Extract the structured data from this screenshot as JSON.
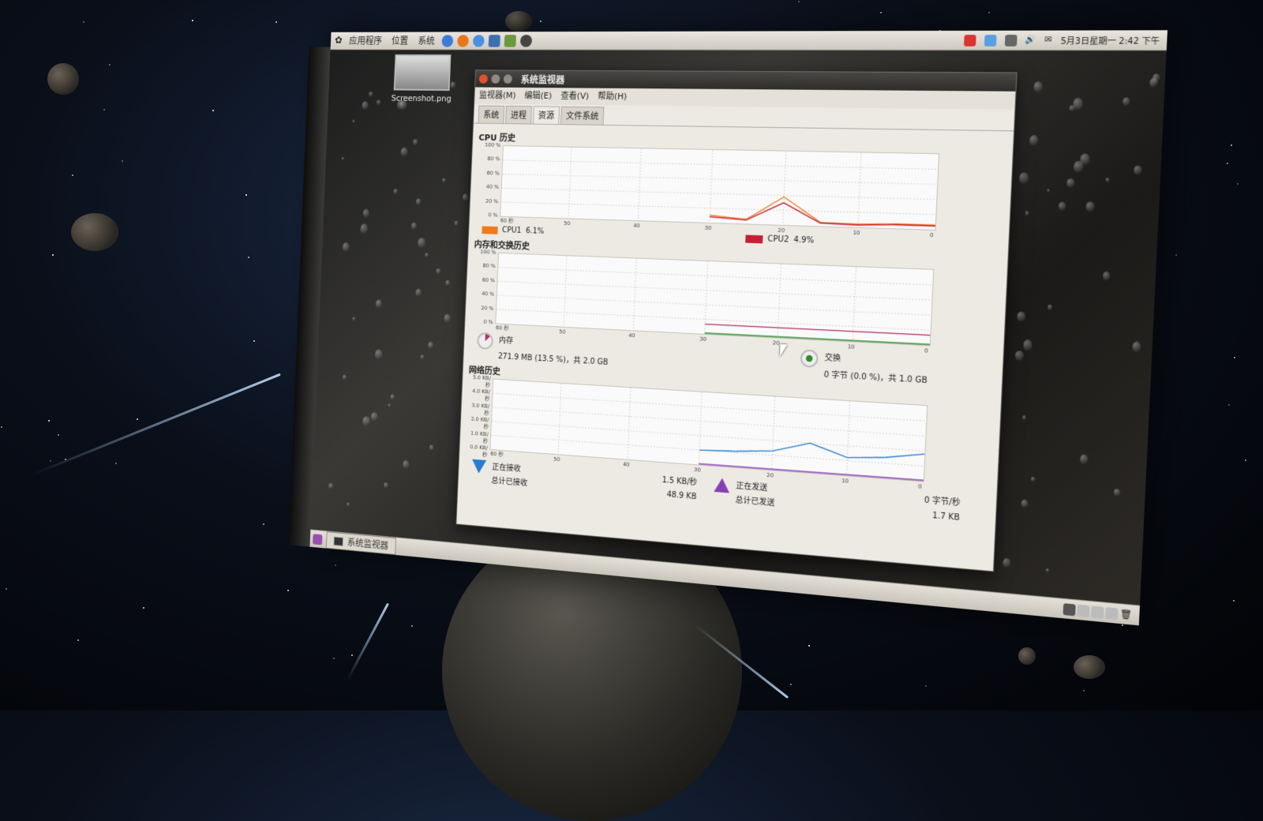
{
  "top_panel": {
    "menus": [
      "应用程序",
      "位置",
      "系统"
    ],
    "clock": "5月3日星期一 2:42 下午"
  },
  "desktop_icon": {
    "label": "Screenshot.png"
  },
  "window": {
    "title": "系统监视器",
    "menus": [
      "监视器(M)",
      "编辑(E)",
      "查看(V)",
      "帮助(H)"
    ],
    "tabs": [
      "系统",
      "进程",
      "资源",
      "文件系统"
    ],
    "active_tab": "资源",
    "cpu": {
      "title": "CPU 历史",
      "y_ticks": [
        "100 %",
        "80 %",
        "60 %",
        "40 %",
        "20 %",
        "0 %"
      ],
      "x_ticks": [
        "60 秒",
        "50",
        "40",
        "30",
        "20",
        "10",
        "0"
      ],
      "cpu1_label": "CPU1",
      "cpu1_value": "6.1%",
      "cpu2_label": "CPU2",
      "cpu2_value": "4.9%"
    },
    "mem": {
      "title": "内存和交换历史",
      "y_ticks": [
        "100 %",
        "80 %",
        "60 %",
        "40 %",
        "20 %",
        "0 %"
      ],
      "x_ticks": [
        "60 秒",
        "50",
        "40",
        "30",
        "20",
        "10",
        "0"
      ],
      "mem_label": "内存",
      "mem_value": "271.9 MB (13.5 %)，共 2.0 GB",
      "swap_label": "交换",
      "swap_value": "0 字节 (0.0 %)，共 1.0 GB"
    },
    "net": {
      "title": "网络历史",
      "y_ticks": [
        "5.0 KB/秒",
        "4.0 KB/秒",
        "3.0 KB/秒",
        "2.0 KB/秒",
        "1.0 KB/秒",
        "0.0 KB/秒"
      ],
      "x_ticks": [
        "60 秒",
        "50",
        "40",
        "30",
        "20",
        "10",
        "0"
      ],
      "recv_label": "正在接收",
      "recv_total_label": "总计已接收",
      "recv_rate": "1.5 KB/秒",
      "recv_total": "48.9 KB",
      "send_label": "正在发送",
      "send_total_label": "总计已发送",
      "send_rate": "0 字节/秒",
      "send_total": "1.7 KB"
    }
  },
  "taskbar": {
    "task_label": "系统监视器"
  },
  "colors": {
    "cpu1": "#f07a1a",
    "cpu2": "#c81e34",
    "mem": "#b3306a",
    "swap": "#2e8b2e",
    "recv": "#2a7bd0",
    "send": "#8a3fb3"
  },
  "chart_data": [
    {
      "type": "line",
      "title": "CPU 历史",
      "x": [
        60,
        50,
        40,
        30,
        25,
        20,
        15,
        10,
        5,
        0
      ],
      "series": [
        {
          "name": "CPU1",
          "values": [
            null,
            null,
            null,
            10,
            6,
            38,
            5,
            4,
            6,
            6.1
          ]
        },
        {
          "name": "CPU2",
          "values": [
            null,
            null,
            null,
            8,
            5,
            30,
            4,
            3,
            5,
            4.9
          ]
        }
      ],
      "ylim": [
        0,
        100
      ]
    },
    {
      "type": "line",
      "title": "内存和交换历史",
      "x": [
        30,
        20,
        10,
        0
      ],
      "series": [
        {
          "name": "内存",
          "values": [
            13.5,
            13.5,
            13.5,
            13.5
          ]
        },
        {
          "name": "交换",
          "values": [
            0,
            0,
            0,
            0
          ]
        }
      ],
      "ylim": [
        0,
        100
      ]
    },
    {
      "type": "line",
      "title": "网络历史",
      "x": [
        30,
        25,
        20,
        15,
        10,
        5,
        0
      ],
      "series": [
        {
          "name": "正在接收",
          "values": [
            1.0,
            1.1,
            1.3,
            2.0,
            1.2,
            1.4,
            1.8
          ]
        },
        {
          "name": "正在发送",
          "values": [
            0,
            0,
            0,
            0,
            0,
            0,
            0
          ]
        }
      ],
      "ylim": [
        0,
        5
      ]
    }
  ]
}
